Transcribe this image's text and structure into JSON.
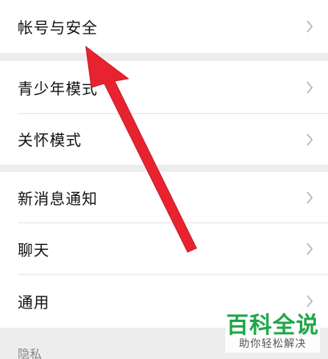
{
  "settings": {
    "group1": {
      "items": [
        {
          "label": "帐号与安全"
        }
      ]
    },
    "group2": {
      "items": [
        {
          "label": "青少年模式"
        },
        {
          "label": "关怀模式"
        }
      ]
    },
    "group3": {
      "items": [
        {
          "label": "新消息通知"
        },
        {
          "label": "聊天"
        },
        {
          "label": "通用"
        }
      ]
    },
    "section_header": "隐私"
  },
  "annotation": {
    "arrow_color": "#e8232f"
  },
  "watermark": {
    "main": "百科全说",
    "sub": "助你轻松解决"
  },
  "colors": {
    "background": "#ededed",
    "row_background": "#ffffff",
    "watermark_green": "#20a64a"
  },
  "icons": [
    "chevron-right-icon",
    "red-arrow-annotation"
  ]
}
